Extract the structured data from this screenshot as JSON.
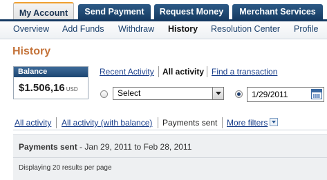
{
  "tabs": [
    {
      "label": "My Account",
      "active": true
    },
    {
      "label": "Send Payment",
      "active": false
    },
    {
      "label": "Request Money",
      "active": false
    },
    {
      "label": "Merchant Services",
      "active": false
    }
  ],
  "subnav": [
    {
      "label": "Overview"
    },
    {
      "label": "Add Funds"
    },
    {
      "label": "Withdraw"
    },
    {
      "label": "History",
      "current": true
    },
    {
      "label": "Resolution Center"
    },
    {
      "label": "Profile"
    }
  ],
  "page_title": "History",
  "balance": {
    "label": "Balance",
    "amount": "$1.506,16",
    "currency": "USD"
  },
  "activity_links": {
    "recent": "Recent Activity",
    "all": "All activity",
    "find": "Find a transaction"
  },
  "filter": {
    "select_value": "Select",
    "date_value": "1/29/2011",
    "date_radio_checked": true
  },
  "filter_tabs": {
    "all_activity": "All activity",
    "all_with_balance": "All activity (with balance)",
    "payments_sent": "Payments sent",
    "more_filters": "More filters"
  },
  "results": {
    "title": "Payments sent",
    "date_range": " - Jan 29, 2011 to Feb 28, 2011",
    "per_page_text": "Displaying 20 results per page"
  },
  "icons": {
    "calendar": "calendar-icon",
    "more_filters": "chevron-down-icon",
    "select_arrow": "dropdown-arrow-icon"
  },
  "colors": {
    "tab_blue": "#173c63",
    "title_orange": "#c4733a",
    "link_blue": "#1a3f8b"
  }
}
